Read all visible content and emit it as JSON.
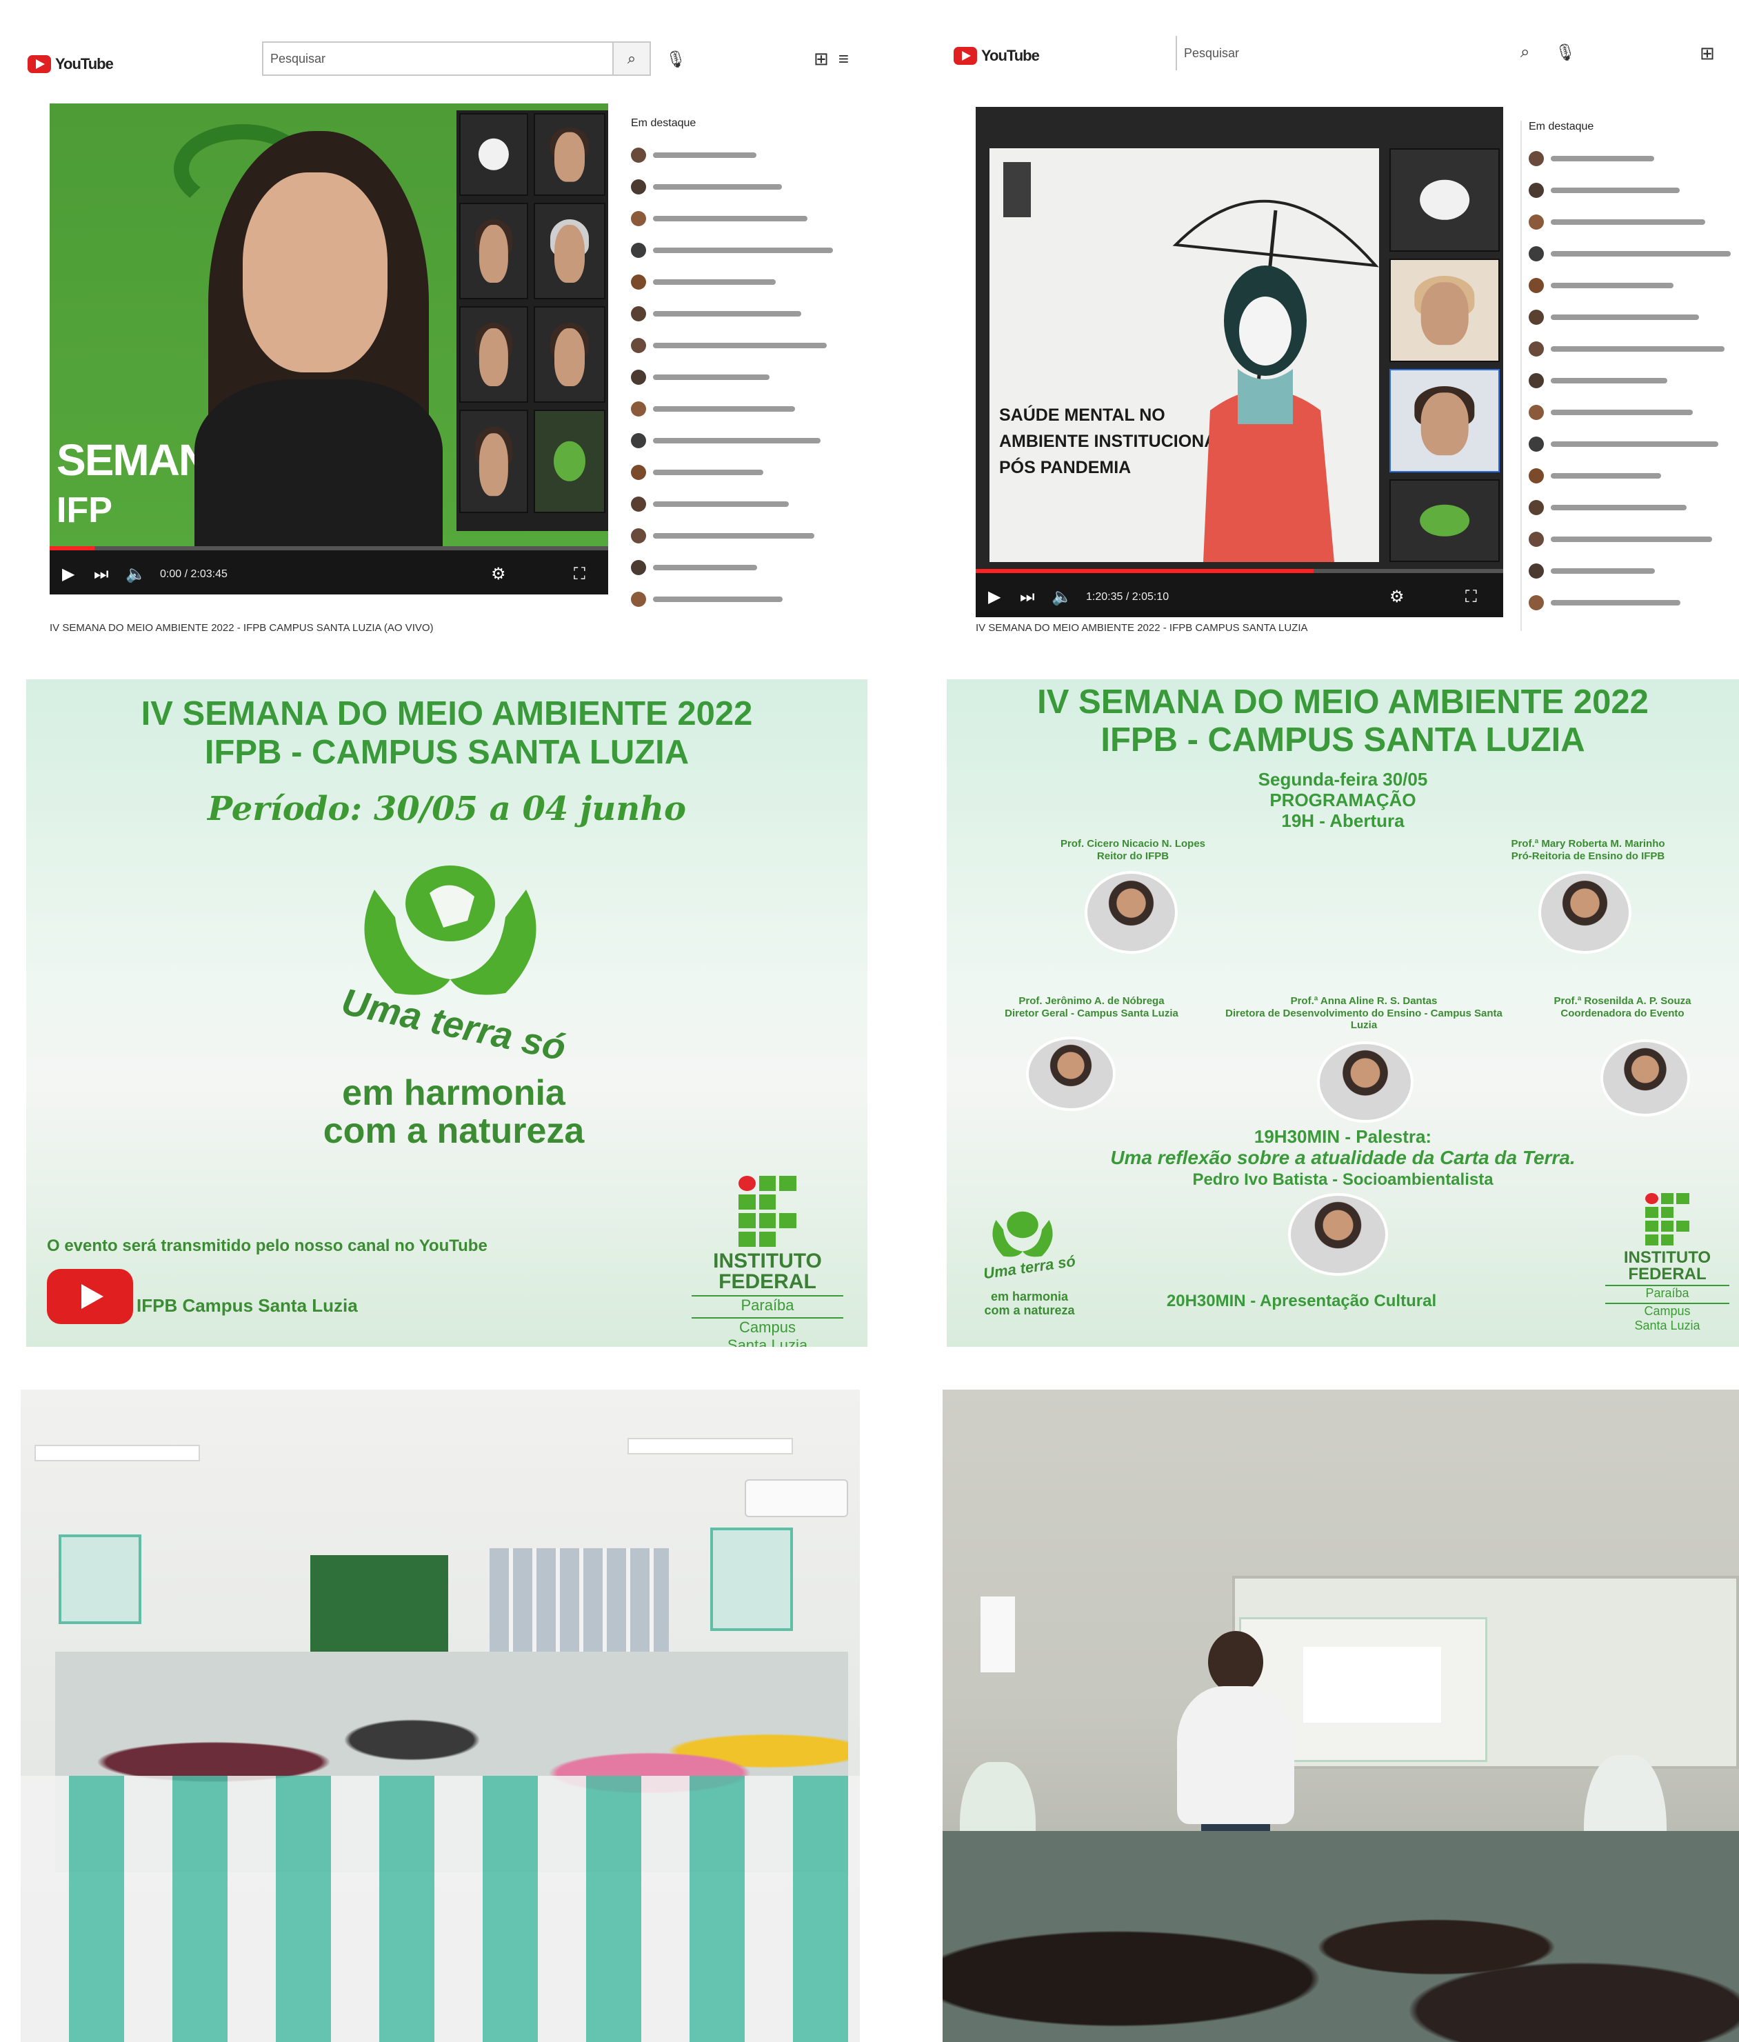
{
  "panel_tl": {
    "logo": "YouTube",
    "search_value": "Pesquisar",
    "chat_title": "Em destaque",
    "chat_items": [
      "",
      "",
      "",
      "",
      "",
      "",
      "",
      "",
      "",
      "",
      "",
      "",
      "",
      "",
      ""
    ],
    "caption": "IV SEMANA DO MEIO AMBIENTE 2022 - IFPB CAMPUS SANTA LUZIA (AO VIVO)",
    "time": "0:00 / 2:03:45"
  },
  "panel_tr": {
    "logo": "YouTube",
    "search_value": "Pesquisar",
    "slide_title_line1": "SAÚDE MENTAL NO",
    "slide_title_line2": "AMBIENTE INSTITUCIONAL",
    "slide_title_line3": "PÓS PANDEMIA",
    "chat_title": "Em destaque",
    "chat_items": [
      "",
      "",
      "",
      "",
      "",
      "",
      "",
      "",
      "",
      "",
      "",
      "",
      "",
      "",
      ""
    ],
    "caption": "IV SEMANA DO MEIO AMBIENTE 2022 - IFPB CAMPUS SANTA LUZIA",
    "time": "1:20:35 / 2:05:10"
  },
  "poster_left": {
    "title1": "IV SEMANA DO MEIO AMBIENTE 2022",
    "title2": "IFPB - CAMPUS SANTA LUZIA",
    "period": "Período: 30/05 a 04 junho",
    "slogan1": "Uma terra só",
    "slogan2": "em harmonia",
    "slogan3": "com a natureza",
    "youtube_note": "O evento será transmitido pelo nosso canal no YouTube",
    "channel": "IFPB Campus Santa Luzia",
    "if_line1": "INSTITUTO",
    "if_line2": "FEDERAL",
    "if_line3": "Paraíba",
    "if_line4": "Campus",
    "if_line5": "Santa Luzia"
  },
  "poster_right": {
    "title1": "IV SEMANA DO MEIO AMBIENTE 2022",
    "title2": "IFPB - CAMPUS SANTA LUZIA",
    "day": "Segunda-feira 30/05",
    "programacao": "PROGRAMAÇÃO",
    "abertura": "19H - Abertura",
    "p1_name": "Prof. Cicero Nicacio N. Lopes",
    "p1_role": "Reitor do IFPB",
    "p2_name": "Prof.ª Mary Roberta M. Marinho",
    "p2_role": "Pró-Reitoria de Ensino do IFPB",
    "p3_name": "Prof. Jerônimo A. de Nóbrega",
    "p3_role": "Diretor Geral - Campus Santa Luzia",
    "p4_name": "Prof.ª Anna Aline R. S. Dantas",
    "p4_role": "Diretora de Desenvolvimento do Ensino - Campus Santa Luzia",
    "p5_name": "Prof.ª Rosenilda A. P. Souza",
    "p5_role": "Coordenadora do Evento",
    "palestra_time": "19H30MIN - Palestra:",
    "palestra_title": "Uma reflexão sobre a atualidade da Carta da Terra.",
    "palestrante": "Pedro Ivo Batista - Socioambientalista",
    "cultural": "20H30MIN - Apresentação Cultural",
    "slogan1": "Uma terra só",
    "slogan2": "em harmonia",
    "slogan3": "com a natureza",
    "if_line1": "INSTITUTO",
    "if_line2": "FEDERAL",
    "if_line3": "Paraíba",
    "if_line4": "Campus",
    "if_line5": "Santa Luzia"
  },
  "colors": {
    "brand_green": "#4fae2e",
    "title_green": "#3a9a3a",
    "youtube_red": "#e02020",
    "if_red": "#e3262b",
    "chair_teal": "#4fbfa8"
  }
}
